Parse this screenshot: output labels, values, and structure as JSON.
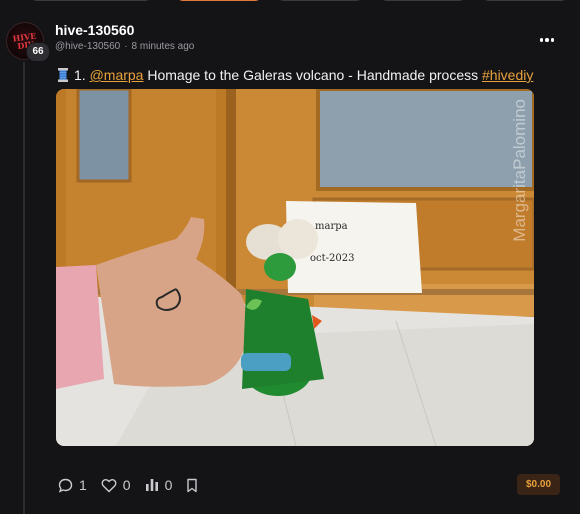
{
  "author": {
    "username": "hive-130560",
    "handle": "@hive-130560",
    "time": "8 minutes ago",
    "reputation": "66",
    "avatar_text": "HIVE DIY"
  },
  "post": {
    "prefix": "1.",
    "mention": "@marpa",
    "text": "Homage to the Galeras volcano - Handmade process",
    "hashtag": "#hivediy",
    "image_alt": "Handmade felt figure of the Galeras volcano next to a hand with a drawn heart and a note reading marpa oct-2023",
    "photo_watermark": "MargaritaPalomino",
    "note_line1": "marpa",
    "note_line2": "oct-2023"
  },
  "actions": {
    "comments": "1",
    "likes": "0",
    "views": "0"
  },
  "payout": "$0.00",
  "icons": {
    "comment": "comment-icon",
    "like": "heart-icon",
    "stats": "bar-chart-icon",
    "bookmark": "bookmark-icon",
    "more": "more-dots-icon",
    "spool": "thread-spool-icon"
  },
  "colors": {
    "background": "#141417",
    "accent": "#e9a23b",
    "payout_bg": "#3a2416",
    "text": "#f2f2f2",
    "muted": "#9a9aa2"
  }
}
